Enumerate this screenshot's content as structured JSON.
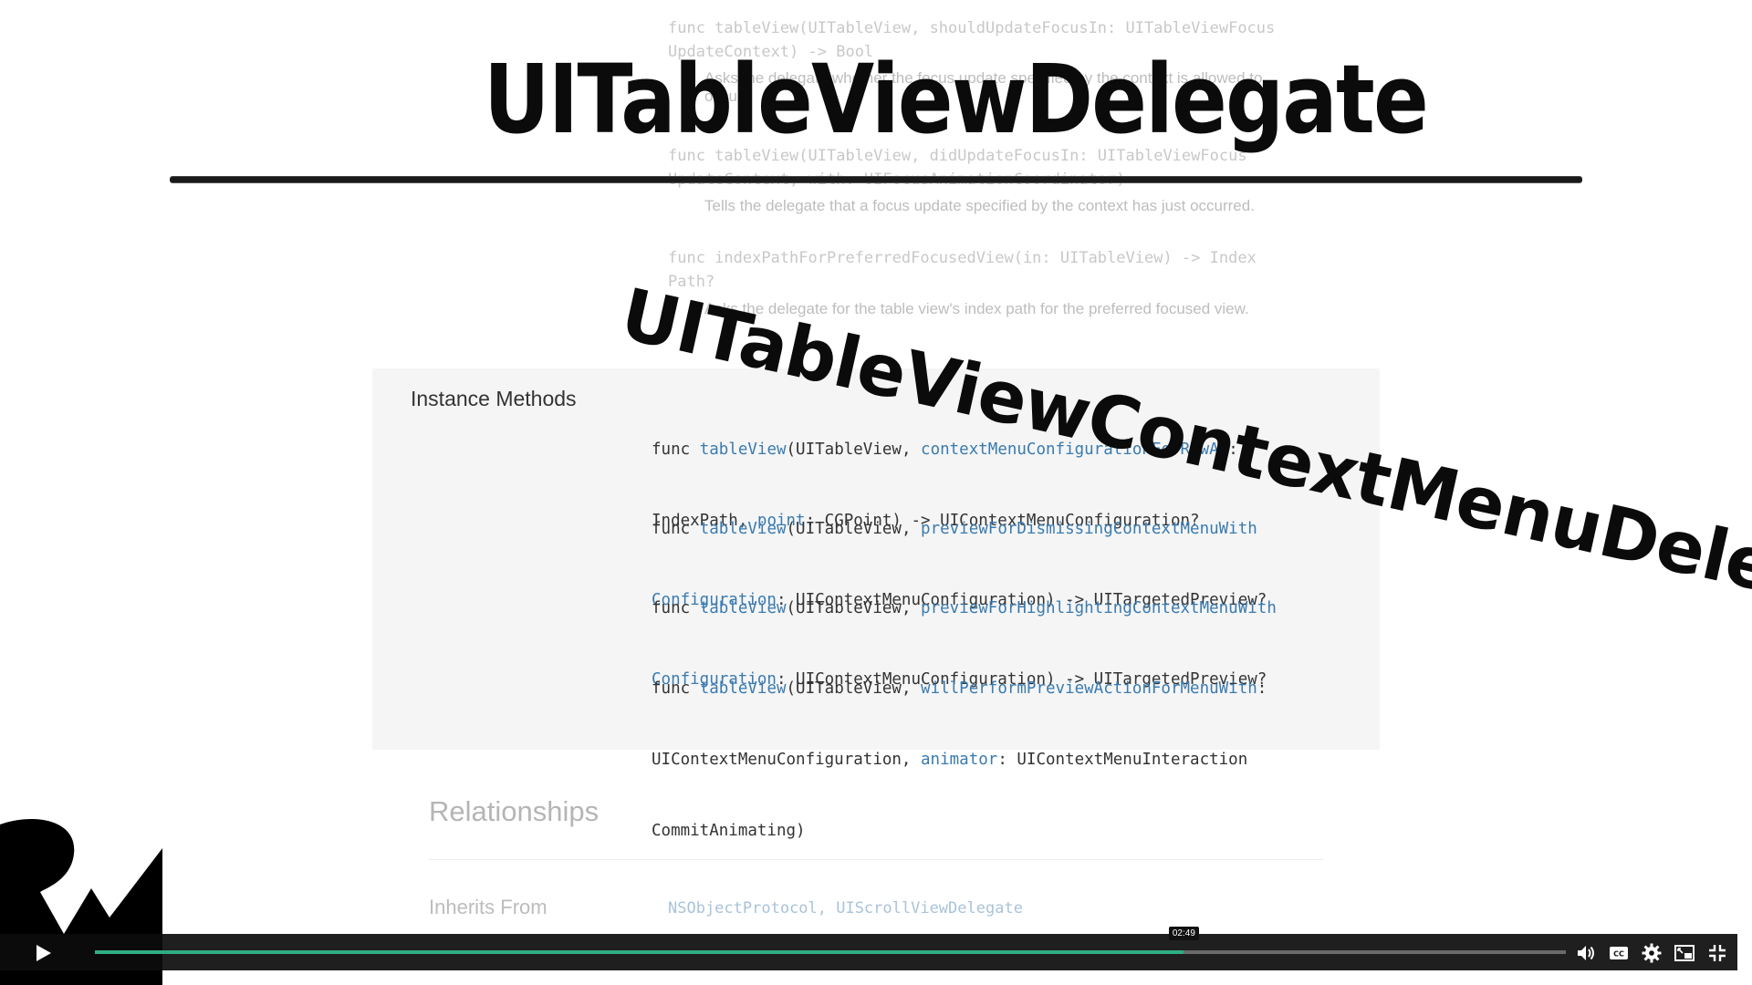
{
  "background_doc": {
    "line1": "func tableView(UITableView, shouldUpdateFocusIn: UITableViewFocus",
    "line2": "UpdateContext) -> Bool",
    "line3": "Asks the delegate whether the focus update specified by the context is allowed to",
    "line4": "occur.",
    "line5": "func tableView(UITableView, didUpdateFocusIn: UITableViewFocus",
    "line6": "UpdateContext, with: UIFocusAnimationCoordinator)",
    "line7": "Tells the delegate that a focus update specified by the context has just occurred.",
    "line8": "func indexPathForPreferredFocusedView(in: UITableView) -> Index",
    "line9": "Path?",
    "line10": "Asks the delegate for the table view's index path for the preferred focused view."
  },
  "overlay": {
    "title_main": "UITableViewDelegate",
    "title_angled": "UITableViewContextMenuDelegate"
  },
  "instance_methods": {
    "heading": "Instance Methods",
    "methods": [
      {
        "l1_pre": "func ",
        "l1_fn": "tableView",
        "l1_mid": "(UITableView, ",
        "l1_param": "contextMenuConfigurationForRowAt",
        "l1_post": ":",
        "l2_pre": "IndexPath, ",
        "l2_param": "point",
        "l2_post": ": CGPoint) -> UIContextMenuConfiguration?"
      },
      {
        "l1_pre": "func ",
        "l1_fn": "tableView",
        "l1_mid": "(UITableView, ",
        "l1_param": "previewForDismissingContextMenuWith",
        "l1_post": "",
        "l2_pre": "",
        "l2_param": "Configuration",
        "l2_post": ": UIContextMenuConfiguration) -> UITargetedPreview?"
      },
      {
        "l1_pre": "func ",
        "l1_fn": "tableView",
        "l1_mid": "(UITableView, ",
        "l1_param": "previewForHighlightingContextMenuWith",
        "l1_post": "",
        "l2_pre": "",
        "l2_param": "Configuration",
        "l2_post": ": UIContextMenuConfiguration) -> UITargetedPreview?"
      },
      {
        "l1_pre": "func ",
        "l1_fn": "tableView",
        "l1_mid": "(UITableView, ",
        "l1_param": "willPerformPreviewActionForMenuWith",
        "l1_post": ":",
        "l2_pre": "UIContextMenuConfiguration, ",
        "l2_param": "animator",
        "l2_post": ": UIContextMenuInteraction",
        "l3": "CommitAnimating)"
      }
    ]
  },
  "relationships": {
    "title": "Relationships",
    "inherits_label": "Inherits From",
    "inherits_value": "NSObjectProtocol, UIScrollViewDelegate"
  },
  "player": {
    "current_time": "02:49",
    "progress_fraction": 0.74,
    "accent_color": "#2fae83",
    "icons": [
      "play-icon",
      "volume-icon",
      "captions-icon",
      "settings-icon",
      "picture-in-picture-icon",
      "fullscreen-exit-icon"
    ]
  }
}
